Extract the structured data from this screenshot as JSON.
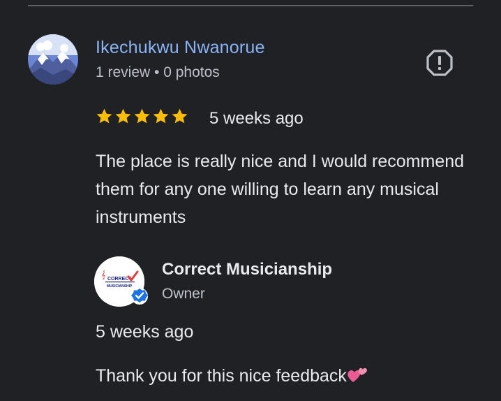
{
  "review": {
    "reviewer_name": "Ikechukwu Nwanorue",
    "reviewer_meta": "1 review • 0 photos",
    "rating": 5,
    "rating_max": 5,
    "date": "5 weeks ago",
    "text": "The place is really nice and I would recommend them for any one willing to learn any musical instruments",
    "report_icon": "report-icon"
  },
  "owner_response": {
    "name": "Correct Musicianship",
    "role": "Owner",
    "logo_text": [
      "CORRECT",
      "MUSICIANSHIP"
    ],
    "date": "5 weeks ago",
    "text": "Thank you for this nice feedback",
    "emoji_icon": "two-hearts-icon"
  },
  "colors": {
    "background": "#202124",
    "name_link": "#8ab4f8",
    "star": "#fbbc04",
    "verified": "#1a73e8",
    "heart": "#f06292"
  }
}
